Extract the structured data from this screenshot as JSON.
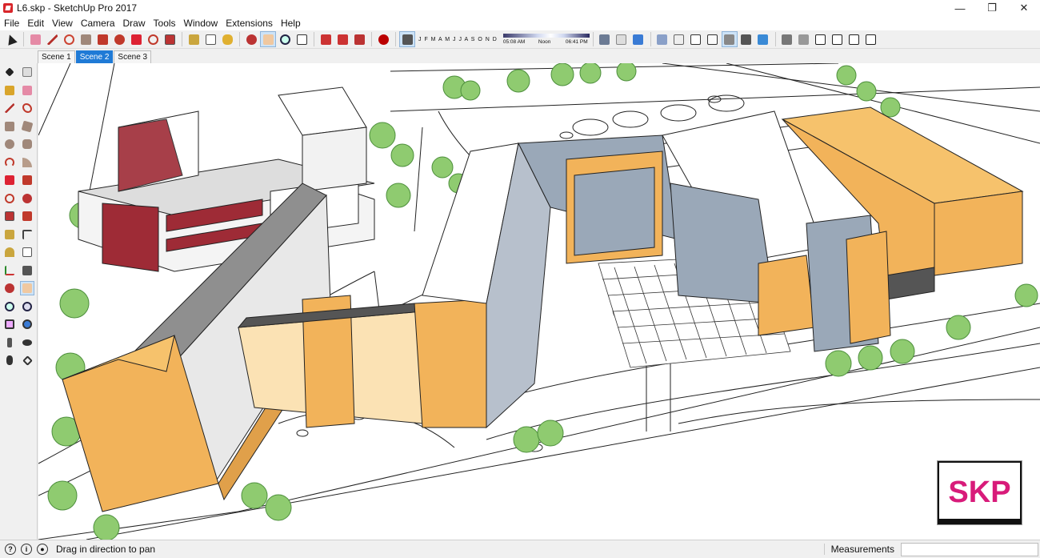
{
  "window": {
    "title": "L6.skp - SketchUp Pro 2017",
    "controls": [
      "—",
      "❐",
      "✕"
    ]
  },
  "menu": [
    "File",
    "Edit",
    "View",
    "Camera",
    "Draw",
    "Tools",
    "Window",
    "Extensions",
    "Help"
  ],
  "shadow": {
    "months": "J F M A M J J A S O N D",
    "time_start": "05:08 AM",
    "time_mid": "Noon",
    "time_end": "06:41 PM"
  },
  "scenes": [
    "Scene 1",
    "Scene 2",
    "Scene 3"
  ],
  "active_scene": "Scene 2",
  "status": {
    "message": "Drag in direction to pan",
    "measurements_label": "Measurements",
    "measurements_value": ""
  },
  "logo": {
    "text": "SKP"
  },
  "colors": {
    "accent": "#1f7ad6",
    "building_orange": "#f2b35a",
    "building_red": "#9e2b36",
    "logo_pink": "#d81b7a"
  }
}
